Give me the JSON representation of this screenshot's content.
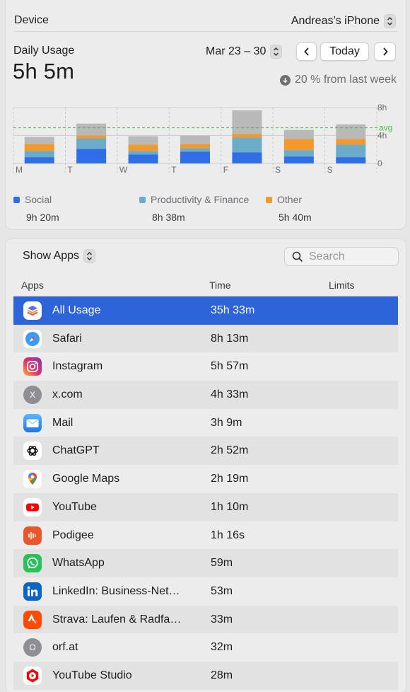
{
  "device": {
    "label": "Device",
    "value": "Andreas’s iPhone"
  },
  "daily": {
    "title": "Daily Usage",
    "total": "5h 5m",
    "range": "Mar 23 – 30",
    "today_label": "Today",
    "change_text": "20 % from last week"
  },
  "colors": {
    "social": "#2f6ee6",
    "productivity": "#6aacc9",
    "other": "#f2992e",
    "remainder": "#b9b9b9",
    "selection": "#2d64d8",
    "avg_line": "#4cb84c"
  },
  "chart_data": {
    "type": "bar",
    "stacked": true,
    "categories": [
      "M",
      "T",
      "W",
      "T",
      "F",
      "S",
      "S"
    ],
    "y_ticks": [
      "8h",
      "4h",
      "0"
    ],
    "ylim": [
      0,
      8
    ],
    "avg_label": "avg",
    "avg_value": 5.1,
    "series": [
      {
        "name": "Social",
        "key": "social",
        "values": [
          0.9,
          2.1,
          1.3,
          1.7,
          1.6,
          1.0,
          0.9
        ]
      },
      {
        "name": "Productivity & Finance",
        "key": "productivity",
        "values": [
          0.9,
          1.5,
          0.5,
          0.5,
          2.1,
          0.9,
          1.8
        ]
      },
      {
        "name": "Other",
        "key": "other",
        "values": [
          1.0,
          0.4,
          0.9,
          0.6,
          0.5,
          1.6,
          0.8
        ]
      },
      {
        "key": "remainder",
        "values": [
          1.0,
          1.7,
          1.2,
          1.2,
          3.4,
          1.3,
          2.1
        ]
      }
    ]
  },
  "legend": [
    {
      "label": "Social",
      "value": "9h 20m",
      "color_key": "social"
    },
    {
      "label": "Productivity & Finance",
      "value": "8h 38m",
      "color_key": "productivity"
    },
    {
      "label": "Other",
      "value": "5h 40m",
      "color_key": "other"
    }
  ],
  "apps_panel": {
    "show_apps_label": "Show Apps",
    "search_placeholder": "Search",
    "headers": {
      "apps": "Apps",
      "time": "Time",
      "limits": "Limits"
    },
    "rows": [
      {
        "name": "All Usage",
        "time": "35h 33m",
        "icon": "layers-icon",
        "selected": true
      },
      {
        "name": "Safari",
        "time": "8h 13m",
        "icon": "safari-icon"
      },
      {
        "name": "Instagram",
        "time": "5h 57m",
        "icon": "instagram-icon"
      },
      {
        "name": "x.com",
        "time": "4h 33m",
        "icon": "letter-icon",
        "letter": "X"
      },
      {
        "name": "Mail",
        "time": "3h 9m",
        "icon": "mail-icon"
      },
      {
        "name": "ChatGPT",
        "time": "2h 52m",
        "icon": "chatgpt-icon"
      },
      {
        "name": "Google Maps",
        "time": "2h 19m",
        "icon": "maps-pin-icon"
      },
      {
        "name": "YouTube",
        "time": "1h 10m",
        "icon": "youtube-icon"
      },
      {
        "name": "Podigee",
        "time": "1h 16s",
        "icon": "podigee-icon"
      },
      {
        "name": "WhatsApp",
        "time": "59m",
        "icon": "whatsapp-icon"
      },
      {
        "name": "LinkedIn: Business-Net…",
        "time": "53m",
        "icon": "linkedin-icon"
      },
      {
        "name": "Strava: Laufen & Radfa…",
        "time": "33m",
        "icon": "strava-icon"
      },
      {
        "name": "orf.at",
        "time": "32m",
        "icon": "letter-icon",
        "letter": "O"
      },
      {
        "name": "YouTube Studio",
        "time": "28m",
        "icon": "youtube-studio-icon"
      }
    ]
  }
}
